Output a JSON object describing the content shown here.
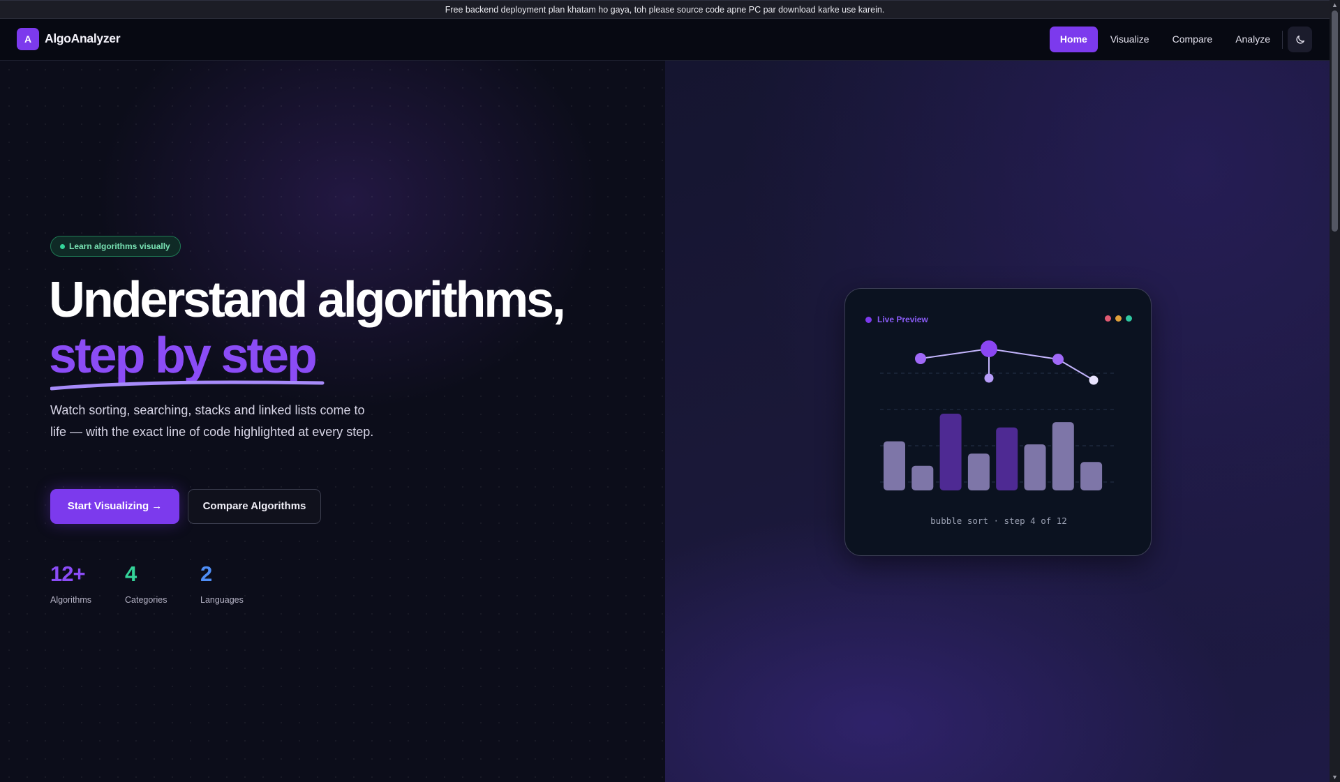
{
  "banner": {
    "text": "Free backend deployment plan khatam ho gaya, toh please source code apne PC par download karke use karein."
  },
  "header": {
    "logo_letter": "A",
    "brand": "AlgoAnalyzer",
    "nav": [
      {
        "label": "Home",
        "active": true
      },
      {
        "label": "Visualize",
        "active": false
      },
      {
        "label": "Compare",
        "active": false
      },
      {
        "label": "Analyze",
        "active": false
      }
    ],
    "theme_icon": "moon-icon"
  },
  "hero": {
    "badge": "Learn algorithms visually",
    "title_line1": "Understand algorithms,",
    "title_line2": "step by step",
    "subtitle": "Watch sorting, searching, stacks and linked lists come to life — with the exact line of code highlighted at every step.",
    "primary_button": "Start Visualizing →",
    "secondary_button": "Compare Algorithms",
    "stats": [
      {
        "value": "12+",
        "label": "Algorithms",
        "color": "#8b4cf6"
      },
      {
        "value": "4",
        "label": "Categories",
        "color": "#34d399"
      },
      {
        "value": "2",
        "label": "Languages",
        "color": "#4f8ef7"
      }
    ]
  },
  "preview": {
    "title": "Live Preview",
    "window_dots": [
      "#e05a72",
      "#e0a03a",
      "#2fc7a0"
    ],
    "caption": "bubble sort · step 4 of 12",
    "bars": [
      {
        "value": 0.64,
        "highlighted": false
      },
      {
        "value": 0.32,
        "highlighted": false
      },
      {
        "value": 1.0,
        "highlighted": true
      },
      {
        "value": 0.48,
        "highlighted": false
      },
      {
        "value": 0.82,
        "highlighted": true
      },
      {
        "value": 0.6,
        "highlighted": false
      },
      {
        "value": 0.89,
        "highlighted": false
      },
      {
        "value": 0.37,
        "highlighted": false
      }
    ],
    "colors": {
      "bar": "#7e76a8",
      "bar_highlight": "#4e2a93",
      "node": "#8b5cf6",
      "node_light": "#b79cf9",
      "accent": "#7c3aed"
    }
  }
}
